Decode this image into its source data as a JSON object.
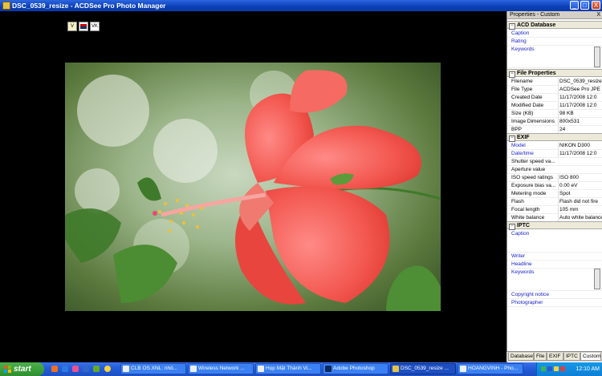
{
  "window": {
    "title": "DSC_0539_resize - ACDSee Pro Photo Manager",
    "buttons": {
      "minimize": "_",
      "maximize": "□",
      "close": "X"
    }
  },
  "viewer": {
    "overlay_buttons": [
      "V",
      "",
      "VK"
    ]
  },
  "panel": {
    "title": "Properties - Custom",
    "close": "X",
    "sections": {
      "acd": "ACD Database",
      "file": "File Properties",
      "exif": "EXIF",
      "iptc": "IPTC"
    },
    "acd_rows": [
      {
        "key": "Caption",
        "value": ""
      },
      {
        "key": "Rating",
        "value": ""
      },
      {
        "key": "Keywords",
        "value": ""
      }
    ],
    "file_rows": [
      {
        "key": "Filename",
        "value": "DSC_0539_resize"
      },
      {
        "key": "File Type",
        "value": "ACDSee Pro JPE"
      },
      {
        "key": "Created Date",
        "value": "11/17/2008 12:0"
      },
      {
        "key": "Modified Date",
        "value": "11/17/2008 12:0"
      },
      {
        "key": "Size (KB)",
        "value": "98 KB"
      },
      {
        "key": "Image Dimensions",
        "value": "800x531"
      },
      {
        "key": "BPP",
        "value": "24"
      }
    ],
    "exif_rows": [
      {
        "key": "Model",
        "value": "NIKON D300"
      },
      {
        "key": "Date/time",
        "value": "11/17/2008 12:0"
      },
      {
        "key": "Shutter speed va...",
        "value": ""
      },
      {
        "key": "Aperture value",
        "value": ""
      },
      {
        "key": "ISO speed ratings",
        "value": "ISO 800"
      },
      {
        "key": "Exposure bias va...",
        "value": "0.00 eV"
      },
      {
        "key": "Metering mode",
        "value": "Spot"
      },
      {
        "key": "Flash",
        "value": "Flash did not fire"
      },
      {
        "key": "Focal length",
        "value": "105 mm"
      },
      {
        "key": "White balance",
        "value": "Auto white balance"
      }
    ],
    "iptc_rows": [
      {
        "key": "Caption",
        "value": ""
      },
      {
        "key": "Writer",
        "value": ""
      },
      {
        "key": "Headline",
        "value": ""
      },
      {
        "key": "Keywords",
        "value": ""
      },
      {
        "key": "Copyright notice",
        "value": ""
      },
      {
        "key": "Photographer",
        "value": ""
      }
    ],
    "tabs": [
      "Database",
      "File",
      "EXIF",
      "IPTC",
      "Custom"
    ]
  },
  "taskbar": {
    "start": "start",
    "tasks": [
      "CLB OS.XNL: nhỏ...",
      "Wireless Network ...",
      "Họp Mặt Thành Vi...",
      "Adobe Photoshop",
      "DSC_0539_resize ...",
      "HOANGVINH - Pho..."
    ],
    "clock": "12:10 AM"
  }
}
